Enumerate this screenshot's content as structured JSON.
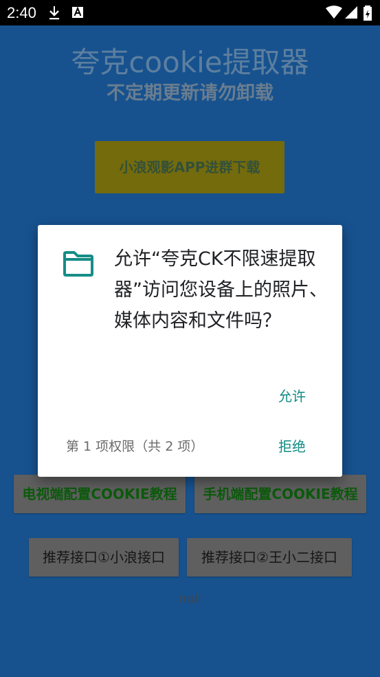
{
  "status_bar": {
    "time": "2:40",
    "icons": [
      "download-icon",
      "a-letter-icon",
      "wifi-icon",
      "signal-icon",
      "battery-icon"
    ]
  },
  "app": {
    "title": "夸克cookie提取器",
    "subtitle": "不定期更新请勿卸载",
    "group_button": "小浪观影APP进群下载",
    "tv_tutorial": "电视端配置COOKIE教程",
    "phone_tutorial": "手机端配置COOKIE教程",
    "api_1": "推荐接口①小浪接口",
    "api_2": "推荐接口②王小二接口",
    "status_text": "null"
  },
  "dialog": {
    "message": "允许“夸克CK不限速提取器”访问您设备上的照片、媒体内容和文件吗？",
    "allow": "允许",
    "permission_count": "第 1 项权限（共 2 项）",
    "deny": "拒绝",
    "icon": "folder-icon"
  },
  "colors": {
    "app_background_dimmed": "#17528f",
    "dialog_accent": "#0f8b83",
    "status_bar": "#000000"
  }
}
